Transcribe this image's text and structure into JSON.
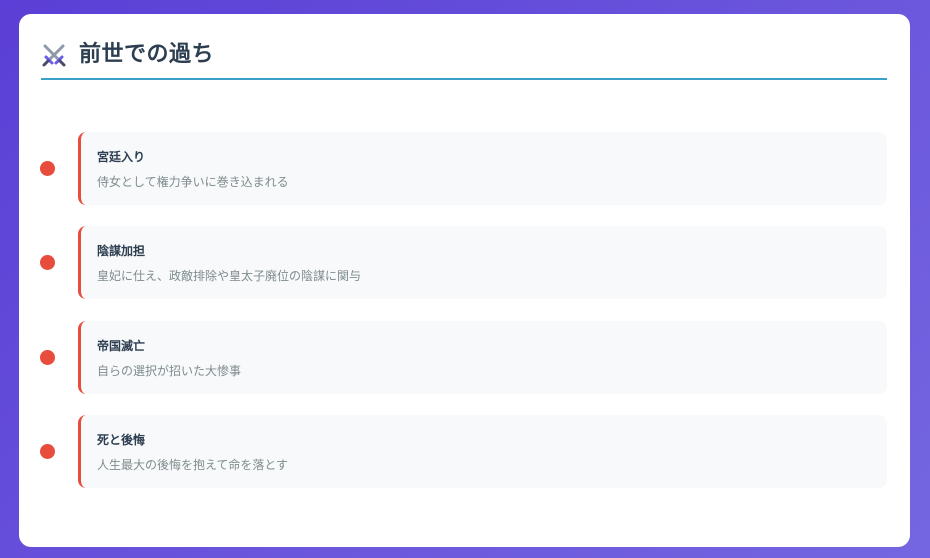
{
  "header": {
    "icon": "crossed-swords-icon",
    "title": "前世での過ち"
  },
  "colors": {
    "accent_line": "#3aa0c8",
    "marker": "#e74c3c",
    "title_text": "#2c3e50",
    "desc_text": "#7f8c8d",
    "background_start": "#5b3fd6",
    "background_end": "#7466e0"
  },
  "timeline": {
    "items": [
      {
        "title": "宮廷入り",
        "description": "侍女として権力争いに巻き込まれる"
      },
      {
        "title": "陰謀加担",
        "description": "皇妃に仕え、政敵排除や皇太子廃位の陰謀に関与"
      },
      {
        "title": "帝国滅亡",
        "description": "自らの選択が招いた大惨事"
      },
      {
        "title": "死と後悔",
        "description": "人生最大の後悔を抱えて命を落とす"
      }
    ]
  }
}
